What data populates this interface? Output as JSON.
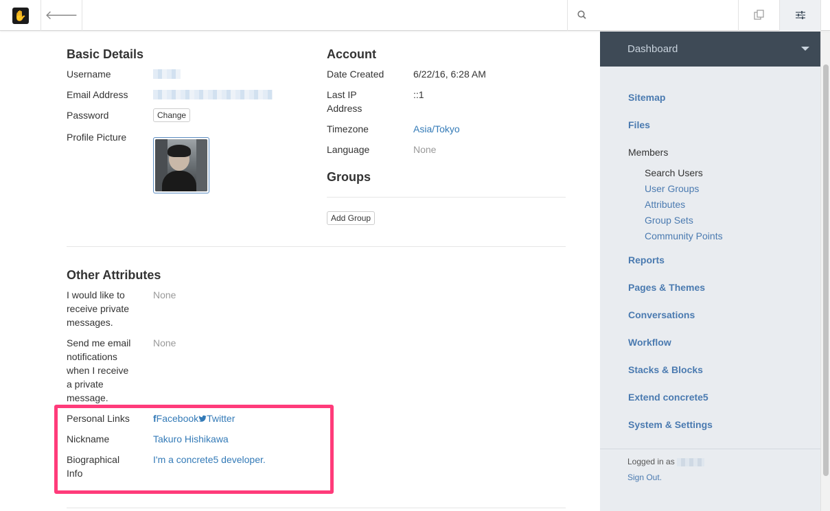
{
  "toolbar": {
    "logo_icon": "concrete5-hand-logo",
    "back_icon": "arrow-left-icon",
    "search_icon": "search-icon",
    "search_value": "",
    "pages_icon": "copy-pages-icon",
    "settings_icon": "sliders-icon"
  },
  "basic_details": {
    "heading": "Basic Details",
    "username_label": "Username",
    "email_label": "Email Address",
    "password_label": "Password",
    "change_button": "Change",
    "profile_picture_label": "Profile Picture"
  },
  "account": {
    "heading": "Account",
    "date_created_label": "Date Created",
    "date_created_value": "6/22/16, 6:28 AM",
    "last_ip_label_line1": "Last IP",
    "last_ip_label_line2": "Address",
    "last_ip_value": "::1",
    "timezone_label": "Timezone",
    "timezone_value": "Asia/Tokyo",
    "language_label": "Language",
    "language_value": "None"
  },
  "groups": {
    "heading": "Groups",
    "add_group_button": "Add Group"
  },
  "other_attributes": {
    "heading": "Other Attributes",
    "items": [
      {
        "label_lines": [
          "I would like to",
          "receive private",
          "messages."
        ],
        "value": "None"
      },
      {
        "label_lines": [
          "Send me email",
          "notifications",
          "when I receive",
          "a private",
          "message."
        ],
        "value": "None"
      }
    ],
    "personal_links_label": "Personal Links",
    "facebook_label": "Facebook",
    "twitter_label": "Twitter",
    "nickname_label": "Nickname",
    "nickname_value": "Takuro Hishikawa",
    "bio_label_line1": "Biographical",
    "bio_label_line2": "Info",
    "bio_value": "I'm a concrete5 developer."
  },
  "panel": {
    "title": "Dashboard",
    "nav": [
      {
        "label": "Sitemap"
      },
      {
        "label": "Files"
      },
      {
        "label": "Members"
      },
      {
        "label": "Reports"
      },
      {
        "label": "Pages & Themes"
      },
      {
        "label": "Conversations"
      },
      {
        "label": "Workflow"
      },
      {
        "label": "Stacks & Blocks"
      },
      {
        "label": "Extend concrete5"
      },
      {
        "label": "System & Settings"
      }
    ],
    "members_sub": [
      {
        "label": "Search Users"
      },
      {
        "label": "User Groups"
      },
      {
        "label": "Attributes"
      },
      {
        "label": "Group Sets"
      },
      {
        "label": "Community Points"
      }
    ],
    "logged_in_prefix": "Logged in as",
    "sign_out": "Sign Out."
  },
  "colors": {
    "link": "#337ab7",
    "panel_header": "#3e4a56",
    "panel_bg": "#e9ecf0",
    "highlight": "#ff3b7a"
  }
}
